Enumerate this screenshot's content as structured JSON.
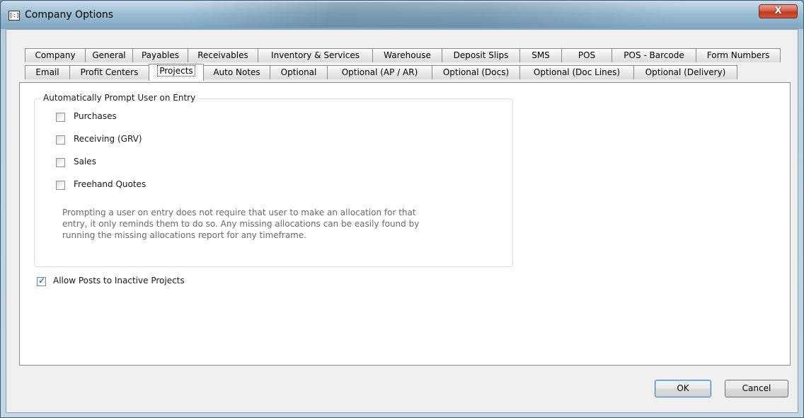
{
  "window": {
    "title": "Company Options",
    "close_label": "X"
  },
  "tabs_row1": [
    {
      "label": "Company"
    },
    {
      "label": "General"
    },
    {
      "label": "Payables"
    },
    {
      "label": "Receivables"
    },
    {
      "label": "Inventory & Services"
    },
    {
      "label": "Warehouse"
    },
    {
      "label": "Deposit Slips"
    },
    {
      "label": "SMS"
    },
    {
      "label": "POS"
    },
    {
      "label": "POS - Barcode"
    },
    {
      "label": "Form Numbers"
    }
  ],
  "tabs_row2": [
    {
      "label": "Email"
    },
    {
      "label": "Profit Centers"
    },
    {
      "label": "Projects",
      "active": true
    },
    {
      "label": "Auto Notes"
    },
    {
      "label": "Optional"
    },
    {
      "label": "Optional (AP / AR)"
    },
    {
      "label": "Optional (Docs)"
    },
    {
      "label": "Optional (Doc Lines)"
    },
    {
      "label": "Optional (Delivery)"
    }
  ],
  "prompt_group": {
    "title": "Automatically Prompt User on Entry",
    "options": [
      {
        "label": "Purchases",
        "checked": false
      },
      {
        "label": "Receiving (GRV)",
        "checked": false
      },
      {
        "label": "Sales",
        "checked": false
      },
      {
        "label": "Freehand Quotes",
        "checked": false
      }
    ],
    "info_lines": [
      "Prompting a user on entry does not require that user to make an allocation for that",
      "entry, it only reminds them to do so. Any missing allocations can be easily found by",
      "running the missing allocations report for any timeframe."
    ]
  },
  "allow_inactive": {
    "label": "Allow Posts to Inactive Projects",
    "checked": true
  },
  "buttons": {
    "ok": "OK",
    "cancel": "Cancel"
  }
}
